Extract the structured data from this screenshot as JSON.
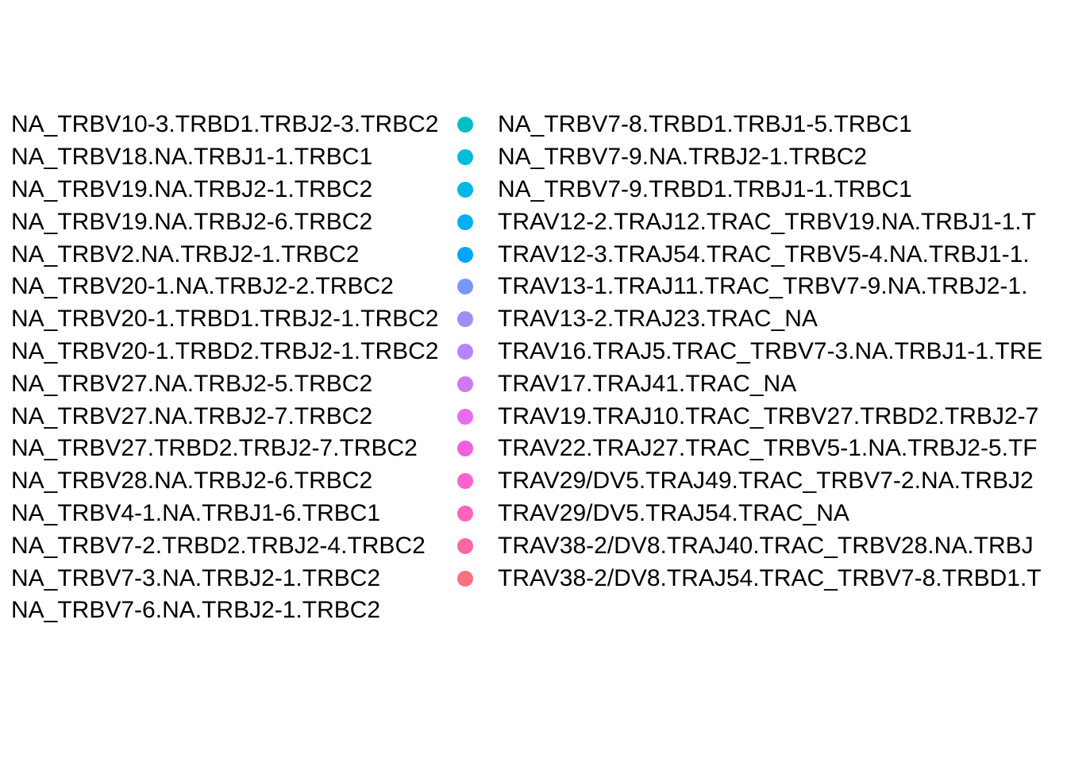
{
  "chart_data": {
    "type": "legend",
    "title": "",
    "legend": {
      "columns": [
        {
          "items": [
            {
              "label": "NA_TRBV10-3.TRBD1.TRBJ2-3.TRBC2",
              "color": "#f8766d"
            },
            {
              "label": "NA_TRBV18.NA.TRBJ1-1.TRBC1",
              "color": "#f27d52"
            },
            {
              "label": "NA_TRBV19.NA.TRBJ2-1.TRBC2",
              "color": "#ea8331"
            },
            {
              "label": "NA_TRBV19.NA.TRBJ2-6.TRBC2",
              "color": "#e18a00"
            },
            {
              "label": "NA_TRBV2.NA.TRBJ2-1.TRBC2",
              "color": "#d89000"
            },
            {
              "label": "NA_TRBV20-1.NA.TRBJ2-2.TRBC2",
              "color": "#cd9600"
            },
            {
              "label": "NA_TRBV20-1.TRBD1.TRBJ2-1.TRBC2",
              "color": "#c09b00"
            },
            {
              "label": "NA_TRBV20-1.TRBD2.TRBJ2-1.TRBC2",
              "color": "#b3a000"
            },
            {
              "label": "NA_TRBV27.NA.TRBJ2-5.TRBC2",
              "color": "#a3a500"
            },
            {
              "label": "NA_TRBV27.NA.TRBJ2-7.TRBC2",
              "color": "#8fa900"
            },
            {
              "label": "NA_TRBV27.TRBD2.TRBJ2-7.TRBC2",
              "color": "#78ad00"
            },
            {
              "label": "NA_TRBV28.NA.TRBJ2-6.TRBC2",
              "color": "#5bb000"
            },
            {
              "label": "NA_TRBV4-1.NA.TRBJ1-6.TRBC1",
              "color": "#25b300"
            },
            {
              "label": "NA_TRBV7-2.TRBD2.TRBJ2-4.TRBC2",
              "color": "#00b52d"
            },
            {
              "label": "NA_TRBV7-3.NA.TRBJ2-1.TRBC2",
              "color": "#00b84c"
            },
            {
              "label": "NA_TRBV7-6.NA.TRBJ2-1.TRBC2",
              "color": "#00ba63"
            }
          ]
        },
        {
          "items": [
            {
              "label": "NA_TRBV7-8.TRBD1.TRBJ1-5.TRBC1",
              "color": "#00bfc4"
            },
            {
              "label": "NA_TRBV7-9.NA.TRBJ2-1.TRBC2",
              "color": "#00bcd8"
            },
            {
              "label": "NA_TRBV7-9.TRBD1.TRBJ1-1.TRBC1",
              "color": "#00b8e7"
            },
            {
              "label": "TRAV12-2.TRAJ12.TRAC_TRBV19.NA.TRBJ1-1.T",
              "color": "#00b0f6"
            },
            {
              "label": "TRAV12-3.TRAJ54.TRAC_TRBV5-4.NA.TRBJ1-1.",
              "color": "#00a5ff"
            },
            {
              "label": "TRAV13-1.TRAJ11.TRAC_TRBV7-9.NA.TRBJ2-1.",
              "color": "#7997ff"
            },
            {
              "label": "TRAV13-2.TRAJ23.TRAC_NA",
              "color": "#9d8ff7"
            },
            {
              "label": "TRAV16.TRAJ5.TRAC_TRBV7-3.NA.TRBJ1-1.TRE",
              "color": "#b983ff"
            },
            {
              "label": "TRAV17.TRAJ41.TRAC_NA",
              "color": "#d078f2"
            },
            {
              "label": "TRAV19.TRAJ10.TRAC_TRBV27.TRBD2.TRBJ2-7",
              "color": "#e76bf3"
            },
            {
              "label": "TRAV22.TRAJ27.TRAC_TRBV5-1.NA.TRBJ2-5.TF",
              "color": "#f45ee0"
            },
            {
              "label": "TRAV29/DV5.TRAJ49.TRAC_TRBV7-2.NA.TRBJ2",
              "color": "#fd61d1"
            },
            {
              "label": "TRAV29/DV5.TRAJ54.TRAC_NA",
              "color": "#ff62bc"
            },
            {
              "label": "TRAV38-2/DV8.TRAJ40.TRAC_TRBV28.NA.TRBJ",
              "color": "#ff67a4"
            },
            {
              "label": "TRAV38-2/DV8.TRAJ54.TRAC_TRBV7-8.TRBD1.T",
              "color": "#fc717f"
            }
          ]
        }
      ]
    }
  }
}
